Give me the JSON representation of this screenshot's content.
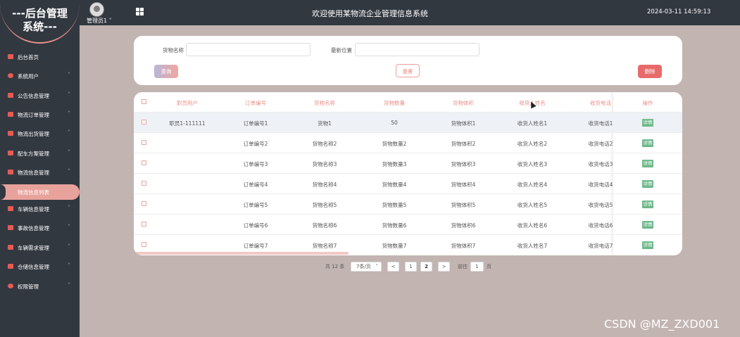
{
  "header": {
    "logo_line1": "---后台管理",
    "logo_line2": "系统---",
    "admin": "管理员1",
    "admin_caret": "˅",
    "title": "欢迎使用某物流企业管理信息系统",
    "datetime": "2024-03-11 14:59:13"
  },
  "sidebar": {
    "items": [
      {
        "label": "后台首页"
      },
      {
        "label": "系统用户",
        "chev": "˅"
      },
      {
        "label": "公告信息管理",
        "chev": "˅"
      },
      {
        "label": "物流订单管理",
        "chev": "˅"
      },
      {
        "label": "物流出货管理",
        "chev": "˅"
      },
      {
        "label": "配车方案管理",
        "chev": "˅"
      },
      {
        "label": "物流信息管理",
        "chev": "˄"
      },
      {
        "label": "车辆信息管理",
        "chev": "˅"
      },
      {
        "label": "事故信息管理",
        "chev": "˅"
      },
      {
        "label": "车辆需求管理",
        "chev": "˅"
      },
      {
        "label": "仓储信息管理",
        "chev": "˅"
      },
      {
        "label": "权限管理",
        "chev": "˅"
      }
    ],
    "active_sub": "物流信息列表"
  },
  "search": {
    "label_name": "货物名称",
    "label_pos": "最新位置",
    "value_name": "",
    "value_pos": "",
    "btn_query": "查询",
    "btn_reset": "重置",
    "btn_delete": "删除"
  },
  "table": {
    "headers": [
      "职员用户",
      "订单编号",
      "货物名称",
      "货物数量",
      "货物体积",
      "收货人姓名",
      "收货电话",
      "操作"
    ],
    "rows": [
      [
        "职员1-111111",
        "订单编号1",
        "货物1",
        "50",
        "货物体积1",
        "收货人姓名1",
        "收货电话1"
      ],
      [
        "",
        "订单编号2",
        "货物名称2",
        "货物数量2",
        "货物体积2",
        "收货人姓名2",
        "收货电话2"
      ],
      [
        "",
        "订单编号3",
        "货物名称3",
        "货物数量3",
        "货物体积3",
        "收货人姓名3",
        "收货电话3"
      ],
      [
        "",
        "订单编号4",
        "货物名称4",
        "货物数量4",
        "货物体积4",
        "收货人姓名4",
        "收货电话4"
      ],
      [
        "",
        "订单编号5",
        "货物名称5",
        "货物数量5",
        "货物体积5",
        "收货人姓名5",
        "收货电话5"
      ],
      [
        "",
        "订单编号6",
        "货物名称6",
        "货物数量6",
        "货物体积6",
        "收货人姓名6",
        "收货电话6"
      ],
      [
        "",
        "订单编号7",
        "货物名称7",
        "货物数量7",
        "货物体积7",
        "收货人姓名7",
        "收货电话7"
      ]
    ],
    "detail_label": "详情"
  },
  "pagination": {
    "total": "共 12 条",
    "page_size": "7条/页",
    "prev": "<",
    "next": ">",
    "page1": "1",
    "page2": "2",
    "goto": "前往",
    "goto_value": "1",
    "page_suffix": "页"
  },
  "colors": {
    "accent": "#e8918a",
    "sidebar": "#323840",
    "detail": "#6fb88a",
    "delete": "#e86a6a"
  },
  "watermark": "CSDN @MZ_ZXD001"
}
